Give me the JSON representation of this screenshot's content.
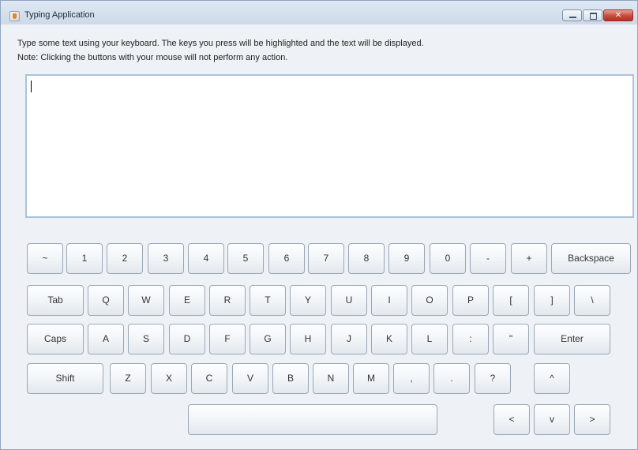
{
  "window": {
    "title": "Typing Application",
    "icon": "java-cup-icon"
  },
  "controls": {
    "minimize": "minimize-icon",
    "maximize": "maximize-icon",
    "close": "close-icon",
    "close_glyph": "✕"
  },
  "instructions": [
    "Type some text using your keyboard.  The keys you press will be highlighted and the text will be displayed.",
    "Note: Clicking the buttons with your mouse will not perform any action."
  ],
  "text_area": {
    "value": ""
  },
  "keyboard": {
    "row1": [
      "~",
      "1",
      "2",
      "3",
      "4",
      "5",
      "6",
      "7",
      "8",
      "9",
      "0",
      "-",
      "+",
      "Backspace"
    ],
    "row2": [
      "Tab",
      "Q",
      "W",
      "E",
      "R",
      "T",
      "Y",
      "U",
      "I",
      "O",
      "P",
      "[",
      "]",
      "\\"
    ],
    "row3": [
      "Caps",
      "A",
      "S",
      "D",
      "F",
      "G",
      "H",
      "J",
      "K",
      "L",
      ":",
      "\"",
      "Enter"
    ],
    "row4": [
      "Shift",
      "Z",
      "X",
      "C",
      "V",
      "B",
      "N",
      "M",
      ",",
      ".",
      "?",
      "^"
    ],
    "row5": [
      "",
      "<",
      "v",
      ">"
    ]
  }
}
